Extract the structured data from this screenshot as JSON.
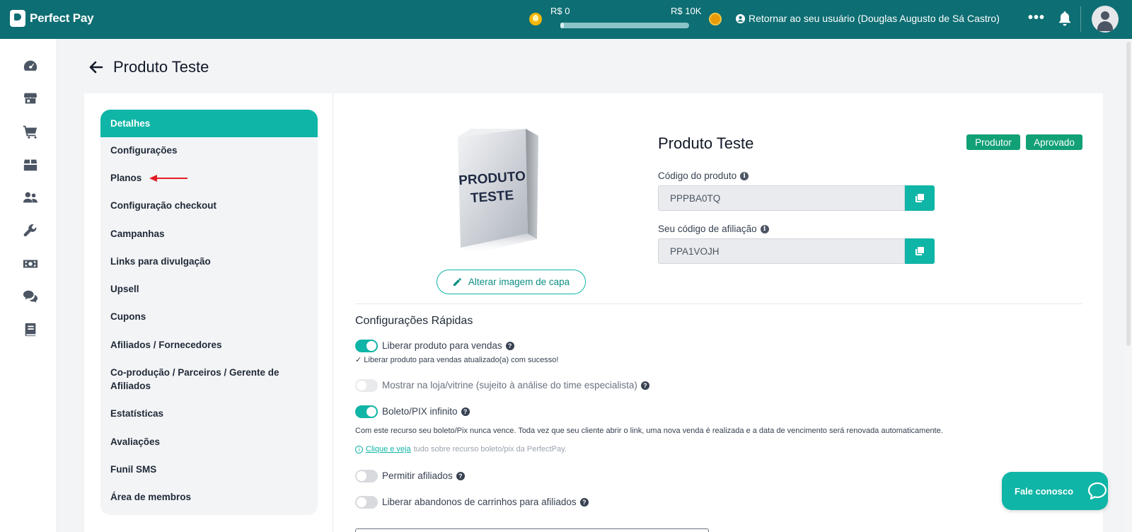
{
  "header": {
    "brand": "Perfect Pay",
    "goal": {
      "min_label": "R$ 0",
      "max_label": "R$ 10K",
      "progress": 0.0
    },
    "return_user_label": "Retornar ao seu usuário (Douglas Augusto de Sá Castro)",
    "more_label": "•••"
  },
  "rail": {
    "icons": [
      "dashboard-icon",
      "store-icon",
      "cart-icon",
      "box-icon",
      "users-icon",
      "wrench-icon",
      "money-icon",
      "chat-icon",
      "book-icon"
    ]
  },
  "page": {
    "title": "Produto Teste"
  },
  "menu": {
    "items": [
      {
        "label": "Detalhes",
        "active": true
      },
      {
        "label": "Configurações"
      },
      {
        "label": "Planos"
      },
      {
        "label": "Configuração checkout"
      },
      {
        "label": "Campanhas"
      },
      {
        "label": "Links para divulgação"
      },
      {
        "label": "Upsell"
      },
      {
        "label": "Cupons"
      },
      {
        "label": "Afiliados / Fornecedores"
      },
      {
        "label": "Co-produção / Parceiros / Gerente de Afiliados"
      },
      {
        "label": "Estatísticas"
      },
      {
        "label": "Avaliações"
      },
      {
        "label": "Funil SMS"
      },
      {
        "label": "Área de membros"
      }
    ]
  },
  "product": {
    "box_text_line1": "PRODUTO",
    "box_text_line2": "TESTE",
    "change_cover_label": "Alterar imagem de capa",
    "name": "Produto Teste",
    "badges": [
      "Produtor",
      "Aprovado"
    ],
    "code_label": "Código do produto",
    "code_value": "PPPBA0TQ",
    "affiliate_label": "Seu código de afiliação",
    "affiliate_value": "PPA1VOJH"
  },
  "quick": {
    "title": "Configurações Rápidas",
    "release_label": "Liberar produto para vendas",
    "release_on": true,
    "release_success": "✓ Liberar produto para vendas atualizado(a) com sucesso!",
    "store_label": "Mostrar na loja/vitrine (sujeito à análise do time especialista)",
    "store_on": false,
    "boleto_label": "Boleto/PIX infinito",
    "boleto_on": true,
    "boleto_desc": "Com este recurso seu boleto/Pix nunca vence. Toda vez que seu cliente abrir o link, uma nova venda é realizada e a data de vencimento será renovada automaticamente.",
    "boleto_link": "Clique e veja",
    "boleto_link_rest": "tudo sobre recurso boleto/pix da PerfectPay.",
    "affiliates_label": "Permitir afiliados",
    "affiliates_on": false,
    "abandon_label": "Liberar abandonos de carrinhos para afiliados",
    "abandon_on": false
  },
  "chat": {
    "label": "Fale conosco"
  },
  "colors": {
    "header": "#0d6e73",
    "accent": "#0fb5a6",
    "badge": "#12a076"
  }
}
